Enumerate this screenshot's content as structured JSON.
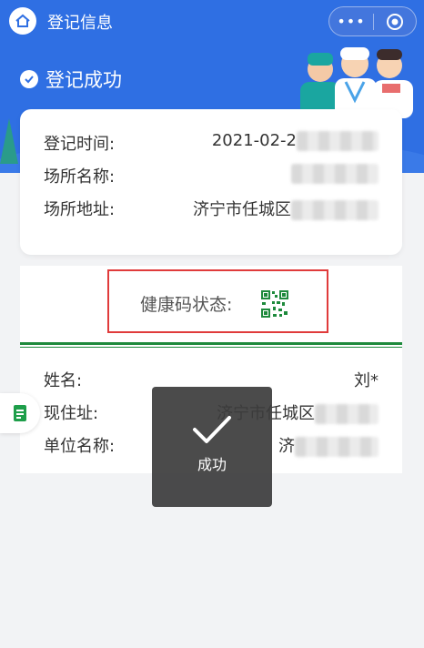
{
  "navbar": {
    "title": "登记信息",
    "more_label": "•••"
  },
  "status": {
    "text": "登记成功"
  },
  "registration": {
    "rows": [
      {
        "label": "登记时间:",
        "value": "2021-02-2"
      },
      {
        "label": "场所名称:",
        "value": ""
      },
      {
        "label": "场所地址:",
        "value": "济宁市任城区"
      }
    ]
  },
  "health": {
    "label": "健康码状态:"
  },
  "person": {
    "rows": [
      {
        "label": "姓名:",
        "value": "刘*"
      },
      {
        "label": "现住址:",
        "value": "济宁市任城区"
      },
      {
        "label": "单位名称:",
        "value": "济"
      }
    ]
  },
  "toast": {
    "text": "成功"
  },
  "colors": {
    "primary": "#2f6fe3",
    "health_green": "#1e8a3c",
    "highlight_red": "#e03b3b"
  }
}
